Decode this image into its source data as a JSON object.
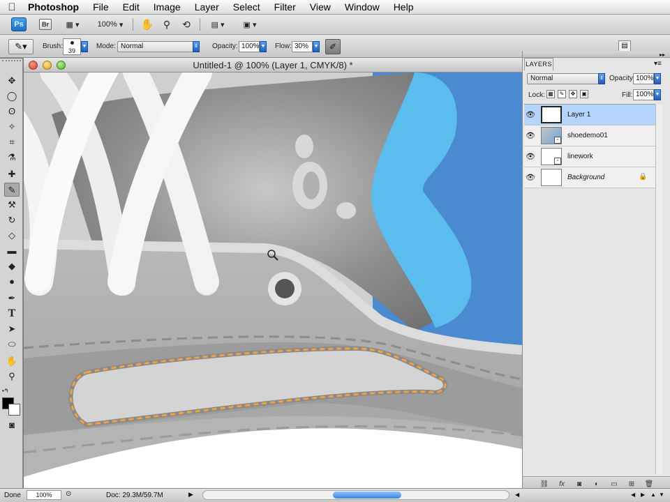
{
  "menubar": {
    "apple_icon": "apple-logo",
    "items": [
      "Photoshop",
      "File",
      "Edit",
      "Image",
      "Layer",
      "Select",
      "Filter",
      "View",
      "Window",
      "Help"
    ]
  },
  "appbar": {
    "ps_label": "Ps",
    "br_label": "Br",
    "zoom": "100%"
  },
  "options": {
    "brush_label": "Brush:",
    "brush_size": "39",
    "mode_label": "Mode:",
    "mode_value": "Normal",
    "opacity_label": "Opacity:",
    "opacity_value": "100%",
    "flow_label": "Flow:",
    "flow_value": "30%"
  },
  "document": {
    "title": "Untitled-1 @ 100% (Layer 1, CMYK/8) *"
  },
  "status": {
    "ready": "Done",
    "zoom": "100%",
    "doc_size": "Doc: 29.3M/59.7M"
  },
  "layers_panel": {
    "tab_label": "LAYERS",
    "blend_mode": "Normal",
    "opacity_label": "Opacity:",
    "opacity_value": "100%",
    "lock_label": "Lock:",
    "fill_label": "Fill:",
    "fill_value": "100%",
    "layers": [
      {
        "name": "Layer 1",
        "selected": true
      },
      {
        "name": "shoedemo01",
        "selected": false
      },
      {
        "name": "linework",
        "selected": false
      },
      {
        "name": "Background",
        "selected": false
      }
    ]
  },
  "colors": {
    "highlight_blue": "#b5d5fc",
    "canvas_blue": "#4a8ad0",
    "canvas_cyan": "#5bbdee",
    "stitch_orange": "#f0a142"
  }
}
